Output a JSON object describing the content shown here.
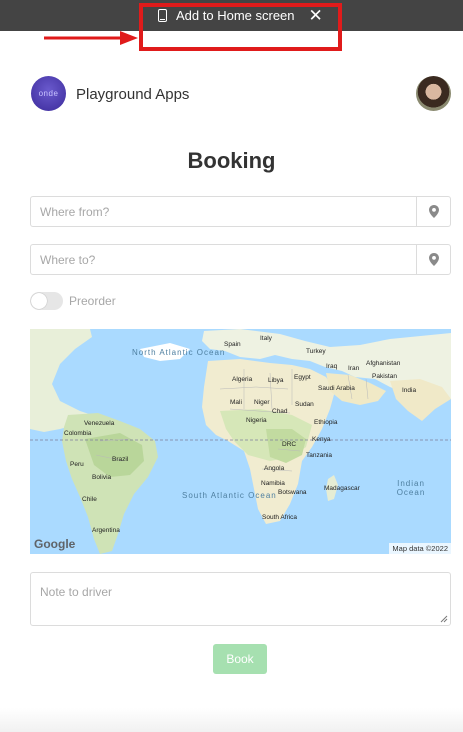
{
  "banner": {
    "label": "Add to Home screen",
    "close_glyph": "✕",
    "icon": "phone-icon",
    "annotation_color": "#e01b1b"
  },
  "header": {
    "app_name": "Playground Apps",
    "logo_text": "onde",
    "logo_color": "#4b3bb8"
  },
  "page": {
    "title": "Booking"
  },
  "form": {
    "from_placeholder": "Where from?",
    "to_placeholder": "Where to?",
    "pin_icon": "map-pin-icon",
    "preorder_label": "Preorder",
    "preorder_enabled": false,
    "note_placeholder": "Note to driver",
    "book_label": "Book",
    "book_color": "#a6e0b0"
  },
  "map": {
    "ocean_labels": {
      "north_atlantic": "North Atlantic Ocean",
      "south_atlantic": "South Atlantic Ocean",
      "indian": "Indian Ocean"
    },
    "country_labels": [
      "Spain",
      "Italy",
      "Turkey",
      "Afghanistan",
      "Iraq",
      "Iran",
      "Pakistan",
      "Algeria",
      "Libya",
      "Egypt",
      "Saudi Arabia",
      "India",
      "Mali",
      "Niger",
      "Chad",
      "Sudan",
      "Nigeria",
      "Ethiopia",
      "Venezuela",
      "Colombia",
      "DRC",
      "Kenya",
      "Tanzania",
      "Brazil",
      "Peru",
      "Bolivia",
      "Angola",
      "Namibia",
      "Botswana",
      "Madagascar",
      "Chile",
      "South Africa",
      "Argentina"
    ],
    "google_logo": "Google",
    "attribution": "Map data ©2022"
  }
}
